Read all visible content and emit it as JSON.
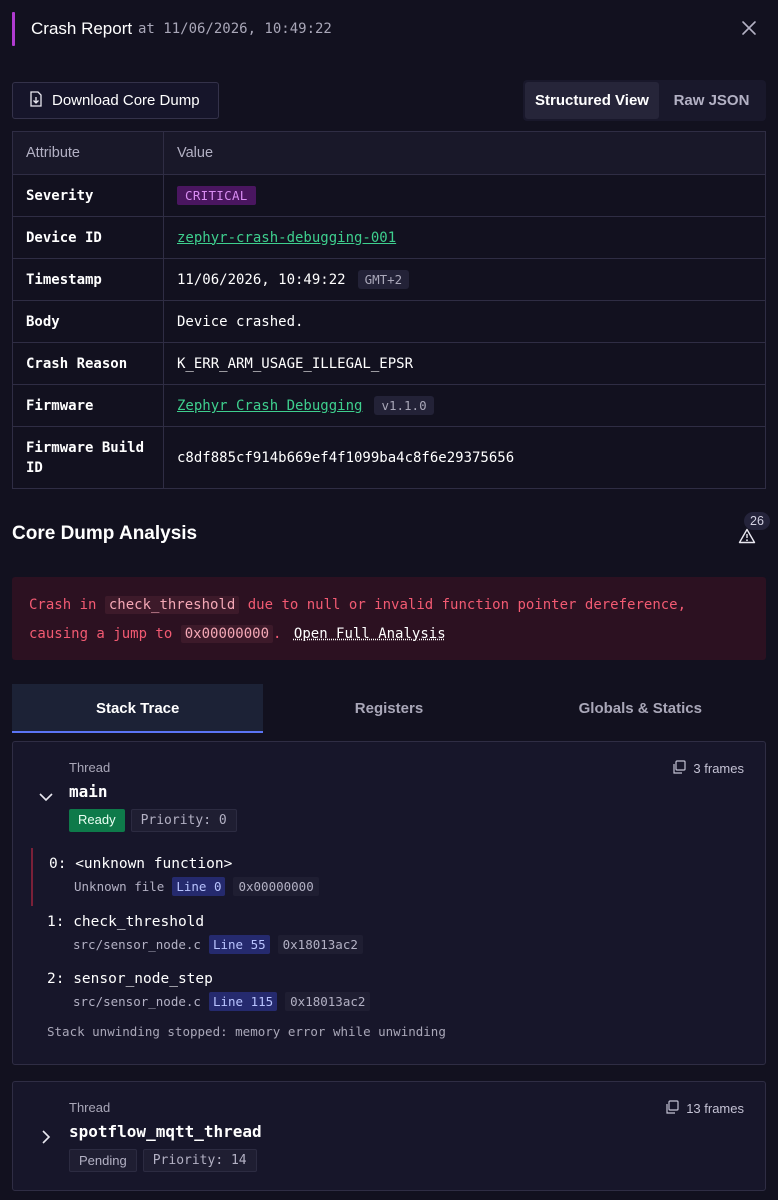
{
  "header": {
    "title": "Crash Report",
    "at_text": "at 11/06/2026, 10:49:22"
  },
  "toolbar": {
    "download_label": "Download Core Dump",
    "view_structured": "Structured View",
    "view_raw": "Raw JSON"
  },
  "table": {
    "col_attribute": "Attribute",
    "col_value": "Value",
    "severity_key": "Severity",
    "severity_value": "CRITICAL",
    "device_key": "Device ID",
    "device_value": "zephyr-crash-debugging-001",
    "timestamp_key": "Timestamp",
    "timestamp_value": "11/06/2026, 10:49:22",
    "timestamp_tz": "GMT+2",
    "body_key": "Body",
    "body_value": "Device crashed.",
    "crash_key": "Crash Reason",
    "crash_value": "K_ERR_ARM_USAGE_ILLEGAL_EPSR",
    "firmware_key": "Firmware",
    "firmware_value": "Zephyr Crash Debugging",
    "firmware_version": "v1.1.0",
    "build_key": "Firmware Build ID",
    "build_value": "c8df885cf914b669ef4f1099ba4c8f6e29375656"
  },
  "core_dump": {
    "title": "Core Dump Analysis",
    "warning_count": "26",
    "banner": {
      "t1": "Crash in",
      "code1": "check_threshold",
      "t2": "due to null or invalid function pointer dereference,",
      "t3": "causing a jump to",
      "code2": "0x00000000",
      "t4": ".",
      "link": "Open Full Analysis"
    }
  },
  "tabs": {
    "stack": "Stack Trace",
    "registers": "Registers",
    "globals": "Globals & Statics"
  },
  "threads": [
    {
      "label": "Thread",
      "name": "main",
      "frames": "3 frames",
      "status": "Ready",
      "priority": "Priority: 0",
      "stack": [
        {
          "fn": "0: <unknown function>",
          "file": "Unknown file",
          "line": "Line 0",
          "addr": "0x00000000"
        },
        {
          "fn": "1: check_threshold",
          "file": "src/sensor_node.c",
          "line": "Line 55",
          "addr": "0x18013ac2"
        },
        {
          "fn": "2: sensor_node_step",
          "file": "src/sensor_node.c",
          "line": "Line 115",
          "addr": "0x18013ac2"
        }
      ],
      "unwind": "Stack unwinding stopped: memory error while unwinding"
    },
    {
      "label": "Thread",
      "name": "spotflow_mqtt_thread",
      "frames": "13 frames",
      "status": "Pending",
      "priority": "Priority: 14"
    }
  ]
}
